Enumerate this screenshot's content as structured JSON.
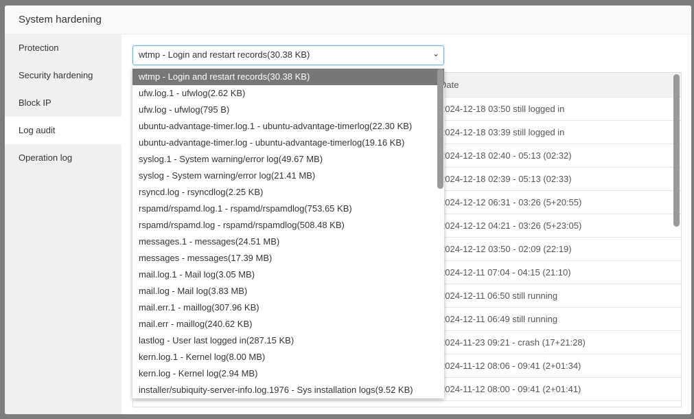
{
  "modal": {
    "title": "System hardening"
  },
  "sidebar": {
    "items": [
      {
        "label": "Protection"
      },
      {
        "label": "Security hardening"
      },
      {
        "label": "Block IP"
      },
      {
        "label": "Log audit"
      },
      {
        "label": "Operation log"
      }
    ]
  },
  "select": {
    "value": "wtmp - Login and restart records(30.38 KB)"
  },
  "dropdown": {
    "options": [
      "wtmp - Login and restart records(30.38 KB)",
      "ufw.log.1 - ufwlog(2.62 KB)",
      "ufw.log - ufwlog(795 B)",
      "ubuntu-advantage-timer.log.1 - ubuntu-advantage-timerlog(22.30 KB)",
      "ubuntu-advantage-timer.log - ubuntu-advantage-timerlog(19.16 KB)",
      "syslog.1 - System warning/error log(49.67 MB)",
      "syslog - System warning/error log(21.41 MB)",
      "rsyncd.log - rsyncdlog(2.25 KB)",
      "rspamd/rspamd.log.1 - rspamd/rspamdlog(753.65 KB)",
      "rspamd/rspamd.log - rspamd/rspamdlog(508.48 KB)",
      "messages.1 - messages(24.51 MB)",
      "messages - messages(17.39 MB)",
      "mail.log.1 - Mail log(3.05 MB)",
      "mail.log - Mail log(3.83 MB)",
      "mail.err.1 - maillog(307.96 KB)",
      "mail.err - maillog(240.62 KB)",
      "lastlog - User last logged in(287.15 KB)",
      "kern.log.1 - Kernel log(8.00 MB)",
      "kern.log - Kernel log(2.94 MB)",
      "installer/subiquity-server-info.log.1976 - Sys installation logs(9.52 KB)"
    ]
  },
  "table": {
    "header": "Date",
    "rows": [
      "2024-12-18 03:50 still logged in",
      "2024-12-18 03:39 still logged in",
      "2024-12-18 02:40 - 05:13 (02:32)",
      "2024-12-18 02:39 - 05:13 (02:33)",
      "2024-12-12 06:31 - 03:26 (5+20:55)",
      "2024-12-12 04:21 - 03:26 (5+23:05)",
      "2024-12-12 03:50 - 02:09 (22:19)",
      "2024-12-11 07:04 - 04:15 (21:10)",
      "2024-12-11 06:50 still running",
      "2024-12-11 06:49 still running",
      "2024-11-23 09:21 - crash (17+21:28)",
      "2024-11-12 08:06 - 09:41 (2+01:34)",
      "2024-11-12 08:00 - 09:41 (2+01:41)"
    ]
  }
}
